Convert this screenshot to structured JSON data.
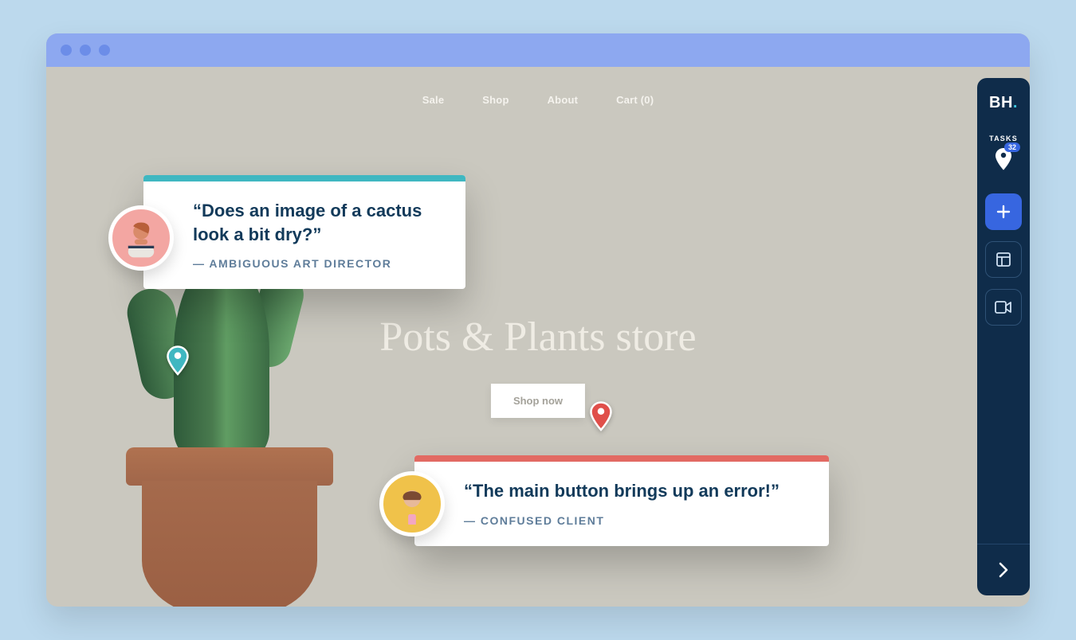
{
  "nav": {
    "items": [
      "Sale",
      "Shop",
      "About"
    ],
    "cart_label": "Cart (0)"
  },
  "hero": {
    "title": "Pots & Plants store",
    "cta": "Shop now"
  },
  "feedback": {
    "card1": {
      "quote": "“Does an image of a cactus look a bit dry?”",
      "attribution": "— AMBIGUOUS ART DIRECTOR"
    },
    "card2": {
      "quote": "“The main button brings up an error!”",
      "attribution": "— CONFUSED CLIENT"
    }
  },
  "sidebar": {
    "logo": "BH",
    "tasks_label": "TASKS",
    "task_count": "32"
  }
}
